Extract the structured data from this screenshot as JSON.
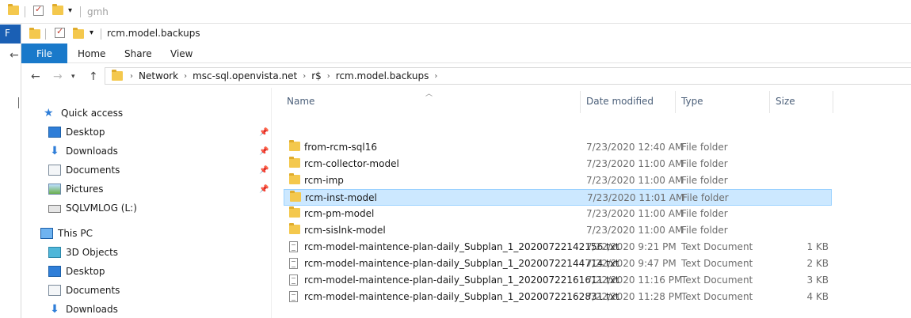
{
  "background_window": {
    "title": "gmh",
    "file_tab": "F"
  },
  "window": {
    "title": "rcm.model.backups"
  },
  "ribbon": {
    "tabs": [
      "File",
      "Home",
      "Share",
      "View"
    ]
  },
  "address": {
    "crumbs": [
      "Network",
      "msc-sql.openvista.net",
      "r$",
      "rcm.model.backups"
    ]
  },
  "nav": {
    "items": [
      {
        "label": "Quick access",
        "icon": "star-icon"
      },
      {
        "label": "Desktop",
        "icon": "desktop-icon",
        "pinned": true
      },
      {
        "label": "Downloads",
        "icon": "downloads-icon",
        "pinned": true
      },
      {
        "label": "Documents",
        "icon": "documents-icon",
        "pinned": true
      },
      {
        "label": "Pictures",
        "icon": "pictures-icon",
        "pinned": true
      },
      {
        "label": "SQLVMLOG (L:)",
        "icon": "drive-icon"
      },
      {
        "label": "This PC",
        "icon": "pc-icon"
      },
      {
        "label": "3D Objects",
        "icon": "3d-objects-icon"
      },
      {
        "label": "Desktop",
        "icon": "desktop-icon"
      },
      {
        "label": "Documents",
        "icon": "documents-icon"
      },
      {
        "label": "Downloads",
        "icon": "downloads-icon"
      }
    ]
  },
  "columns": {
    "name": "Name",
    "date": "Date modified",
    "type": "Type",
    "size": "Size"
  },
  "files": [
    {
      "name": "from-rcm-sql16",
      "date": "7/23/2020 12:40 AM",
      "type": "File folder",
      "size": "",
      "kind": "folder"
    },
    {
      "name": "rcm-collector-model",
      "date": "7/23/2020 11:00 AM",
      "type": "File folder",
      "size": "",
      "kind": "folder"
    },
    {
      "name": "rcm-imp",
      "date": "7/23/2020 11:00 AM",
      "type": "File folder",
      "size": "",
      "kind": "folder"
    },
    {
      "name": "rcm-inst-model",
      "date": "7/23/2020 11:01 AM",
      "type": "File folder",
      "size": "",
      "kind": "folder",
      "selected": true
    },
    {
      "name": "rcm-pm-model",
      "date": "7/23/2020 11:00 AM",
      "type": "File folder",
      "size": "",
      "kind": "folder"
    },
    {
      "name": "rcm-sislnk-model",
      "date": "7/23/2020 11:00 AM",
      "type": "File folder",
      "size": "",
      "kind": "folder"
    },
    {
      "name": "rcm-model-maintence-plan-daily_Subplan_1_20200722142156.txt",
      "date": "7/22/2020 9:21 PM",
      "type": "Text Document",
      "size": "1 KB",
      "kind": "text"
    },
    {
      "name": "rcm-model-maintence-plan-daily_Subplan_1_20200722144714.txt",
      "date": "7/22/2020 9:47 PM",
      "type": "Text Document",
      "size": "2 KB",
      "kind": "text"
    },
    {
      "name": "rcm-model-maintence-plan-daily_Subplan_1_20200722161611.txt",
      "date": "7/22/2020 11:16 PM",
      "type": "Text Document",
      "size": "3 KB",
      "kind": "text"
    },
    {
      "name": "rcm-model-maintence-plan-daily_Subplan_1_20200722162831.txt",
      "date": "7/22/2020 11:28 PM",
      "type": "Text Document",
      "size": "4 KB",
      "kind": "text"
    }
  ]
}
